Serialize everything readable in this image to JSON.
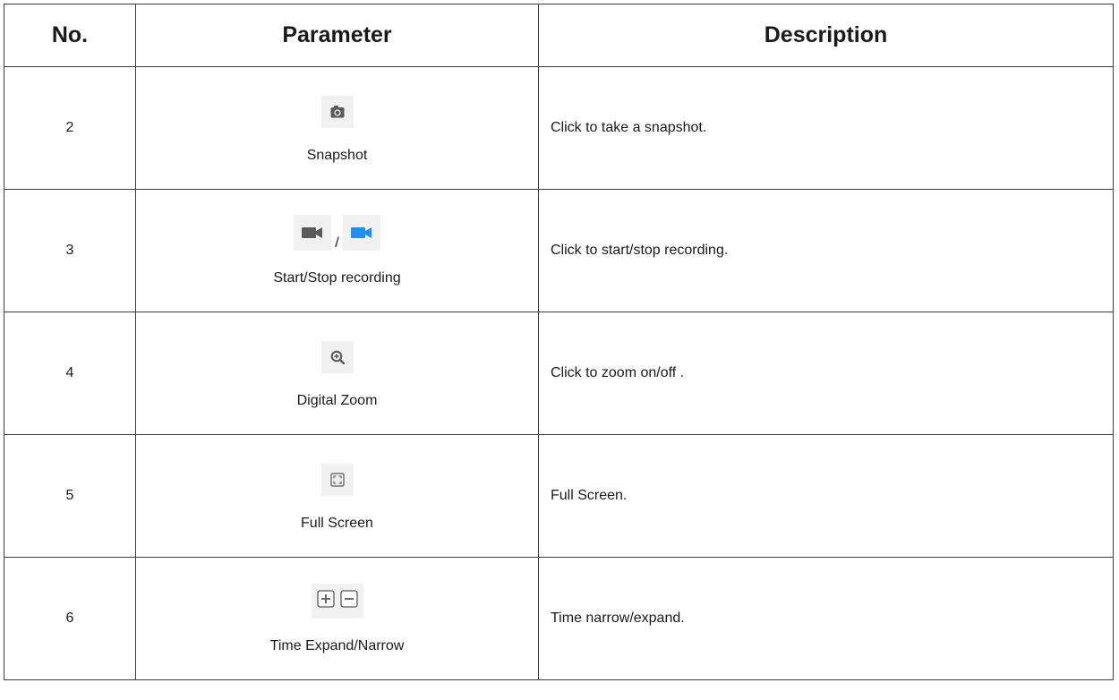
{
  "table": {
    "headers": {
      "no": "No.",
      "parameter": "Parameter",
      "description": "Description"
    },
    "rows": [
      {
        "no": "2",
        "parameter": "Snapshot",
        "description": "Click to take a snapshot.",
        "icons": [
          "camera-icon"
        ]
      },
      {
        "no": "3",
        "parameter": "Start/Stop recording",
        "description": "Click to start/stop recording.",
        "icons": [
          "video-camera-icon",
          "video-camera-active-icon"
        ],
        "separator": "/"
      },
      {
        "no": "4",
        "parameter": "Digital Zoom",
        "description": "Click to zoom on/off .",
        "icons": [
          "zoom-in-icon"
        ]
      },
      {
        "no": "5",
        "parameter": "Full Screen",
        "description": "Full Screen.",
        "icons": [
          "fullscreen-icon"
        ]
      },
      {
        "no": "6",
        "parameter": "Time Expand/Narrow",
        "description": "Time narrow/expand.",
        "icons": [
          "plus-box-icon",
          "minus-box-icon"
        ]
      }
    ]
  },
  "colors": {
    "icon_gray": "#5a5a5a",
    "icon_active_blue": "#1e8ff0",
    "icon_bg": "#f1f1f1",
    "border": "#3c3c3c"
  }
}
